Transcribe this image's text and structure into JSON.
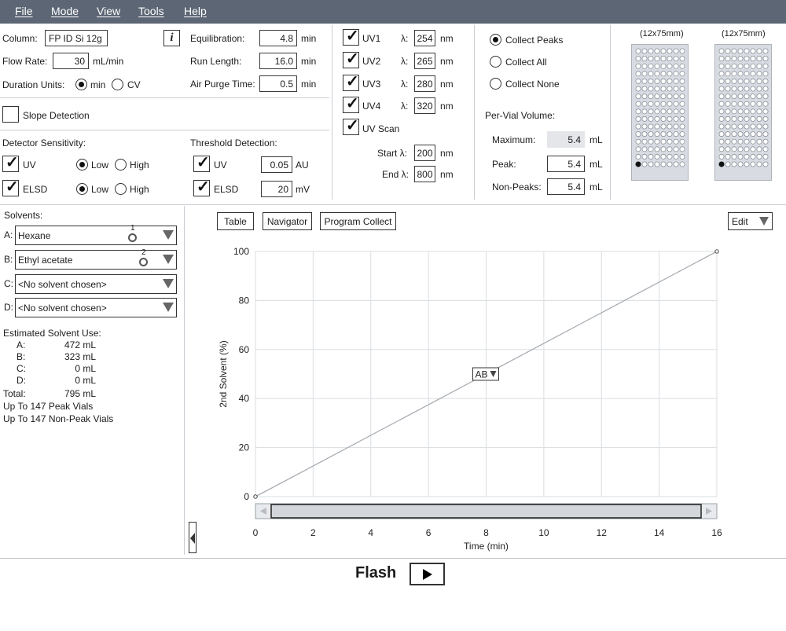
{
  "menu": {
    "file": "File",
    "mode": "Mode",
    "view": "View",
    "tools": "Tools",
    "help": "Help"
  },
  "params": {
    "column_label": "Column:",
    "column_value": "FP ID Si 12g",
    "info_icon": "i",
    "flow_rate_label": "Flow Rate:",
    "flow_rate_value": "30",
    "flow_rate_unit": "mL/min",
    "duration_units_label": "Duration Units:",
    "duration_min": "min",
    "duration_cv": "CV",
    "equilibration_label": "Equilibration:",
    "equilibration_value": "4.8",
    "equilibration_unit": "min",
    "run_length_label": "Run Length:",
    "run_length_value": "16.0",
    "run_length_unit": "min",
    "air_purge_label": "Air Purge Time:",
    "air_purge_value": "0.5",
    "air_purge_unit": "min"
  },
  "slope_detection_label": "Slope Detection",
  "detector": {
    "title": "Detector Sensitivity:",
    "uv_label": "UV",
    "elsd_label": "ELSD",
    "low": "Low",
    "high": "High"
  },
  "threshold": {
    "title": "Threshold Detection:",
    "uv_label": "UV",
    "uv_value": "0.05",
    "uv_unit": "AU",
    "elsd_label": "ELSD",
    "elsd_value": "20",
    "elsd_unit": "mV"
  },
  "uv": {
    "lambda": "λ:",
    "nm": "nm",
    "channels": [
      {
        "label": "UV1",
        "value": "254"
      },
      {
        "label": "UV2",
        "value": "265"
      },
      {
        "label": "UV3",
        "value": "280"
      },
      {
        "label": "UV4",
        "value": "320"
      }
    ],
    "scan_label": "UV Scan",
    "start_label": "Start λ:",
    "start_value": "200",
    "end_label": "End λ:",
    "end_value": "800"
  },
  "collect": {
    "peaks": "Collect Peaks",
    "all": "Collect All",
    "none": "Collect None",
    "per_vial_title": "Per-Vial Volume:",
    "maximum_label": "Maximum:",
    "maximum_value": "5.4",
    "peak_label": "Peak:",
    "peak_value": "5.4",
    "nonpeaks_label": "Non-Peaks:",
    "nonpeaks_value": "5.4",
    "unit": "mL"
  },
  "racks": [
    {
      "label": "(12x75mm)"
    },
    {
      "label": "(12x75mm)"
    }
  ],
  "solvents": {
    "title": "Solvents:",
    "rows": [
      {
        "letter": "A:",
        "name": "Hexane",
        "marker": "1"
      },
      {
        "letter": "B:",
        "name": "Ethyl acetate",
        "marker": "2"
      },
      {
        "letter": "C:",
        "name": "<No solvent chosen>",
        "marker": ""
      },
      {
        "letter": "D:",
        "name": "<No solvent chosen>",
        "marker": ""
      }
    ]
  },
  "estimate": {
    "title": "Estimated Solvent Use:",
    "rows": [
      {
        "label": "A:",
        "value": "472 mL"
      },
      {
        "label": "B:",
        "value": "323 mL"
      },
      {
        "label": "C:",
        "value": "0 mL"
      },
      {
        "label": "D:",
        "value": "0 mL"
      }
    ],
    "total_label": "Total:",
    "total_value": "795 mL",
    "peak_vials": "Up To 147 Peak Vials",
    "nonpeak_vials": "Up To 147 Non-Peak Vials"
  },
  "chart_buttons": {
    "table": "Table",
    "navigator": "Navigator",
    "program_collect": "Program Collect",
    "edit": "Edit"
  },
  "chart_data": {
    "type": "line",
    "xlabel": "Time (min)",
    "ylabel": "2nd Solvent (%)",
    "xlim": [
      0,
      16
    ],
    "ylim": [
      0,
      100
    ],
    "x_ticks": [
      0,
      2,
      4,
      6,
      8,
      10,
      12,
      14,
      16
    ],
    "y_ticks": [
      0,
      20,
      40,
      60,
      80,
      100
    ],
    "grid": true,
    "series": [
      {
        "values": [
          [
            0,
            0
          ],
          [
            16,
            100
          ]
        ]
      }
    ],
    "annotation": {
      "text": "AB",
      "x": 8,
      "y": 50
    }
  },
  "flash": {
    "label": "Flash"
  }
}
